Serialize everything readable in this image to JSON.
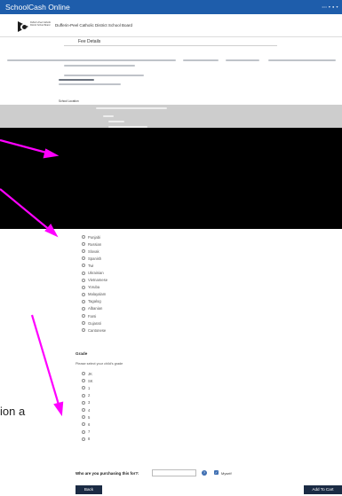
{
  "app": {
    "title": "SchoolCash Online",
    "header_icons": "••• ▾  ● ▾"
  },
  "board": {
    "logo_text": "Dufferin-Peel Catholic District School Board",
    "name": "Dufferin-Peel Catholic District School Board"
  },
  "fee": {
    "title": "Fee Details"
  },
  "school_location_label": "School Location",
  "languages": [
    "Punjabi",
    "Russian",
    "Slovak",
    "Spanish",
    "Twi",
    "Ukrainian",
    "Vietnamese",
    "Yoruba",
    "Malayalam",
    "Tagalog",
    "Albanian",
    "Farsi",
    "Gujarati",
    "Cantonese"
  ],
  "grade": {
    "label": "Grade",
    "help": "Please select your child's grade",
    "options": [
      "JK",
      "SK",
      "1",
      "2",
      "3",
      "4",
      "5",
      "6",
      "7",
      "8"
    ]
  },
  "overlay_text": "ion a",
  "purchase": {
    "label": "Who are you purchasing this for?:",
    "myself": "Myself",
    "help_icon": "?",
    "check_mark": "✓"
  },
  "buttons": {
    "back": "Back",
    "add_to_cart": "Add To Cart"
  },
  "colors": {
    "topbar": "#1e5dab",
    "button": "#1b2b44",
    "arrow": "#ff00ff"
  }
}
